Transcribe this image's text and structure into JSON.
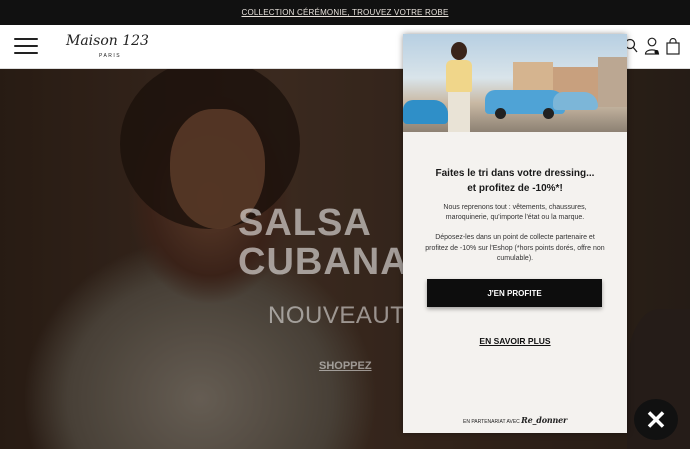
{
  "topbar": {
    "promo_link": "COLLECTION CÉRÉMONIE, TROUVEZ VOTRE ROBE"
  },
  "header": {
    "logo_script": "Maison 123",
    "logo_city": "PARIS"
  },
  "hero": {
    "title_line1": "SALSA",
    "title_line2": "CUBANA",
    "subtitle": "NOUVEAUTÉS",
    "cta": "SHOPPEZ"
  },
  "popup": {
    "headline_line1": "Faites le tri dans votre dressing...",
    "headline_line2": "et profitez de -10%*!",
    "paragraph1": "Nous reprenons tout : vêtements, chaussures, maroquinerie, qu'importe l'état ou la marque.",
    "paragraph2": "Déposez-les dans un point de collecte partenaire et profitez de -10% sur l'Eshop (*hors points dorés, offre non cumulable).",
    "primary_button": "J'EN PROFITE",
    "secondary_link": "EN SAVOIR PLUS",
    "partner_prefix": "EN PARTENARIAT AVEC",
    "partner_name": "Re_donner"
  },
  "close_button": {
    "label": "✕"
  },
  "colors": {
    "topbar_bg": "#111111",
    "popup_bg": "#f4f2ef",
    "button_bg": "#0d0d0d",
    "car_blue": "#4fa3d6"
  },
  "icons": [
    "menu-icon",
    "search-icon",
    "account-icon",
    "bag-icon",
    "close-icon"
  ]
}
